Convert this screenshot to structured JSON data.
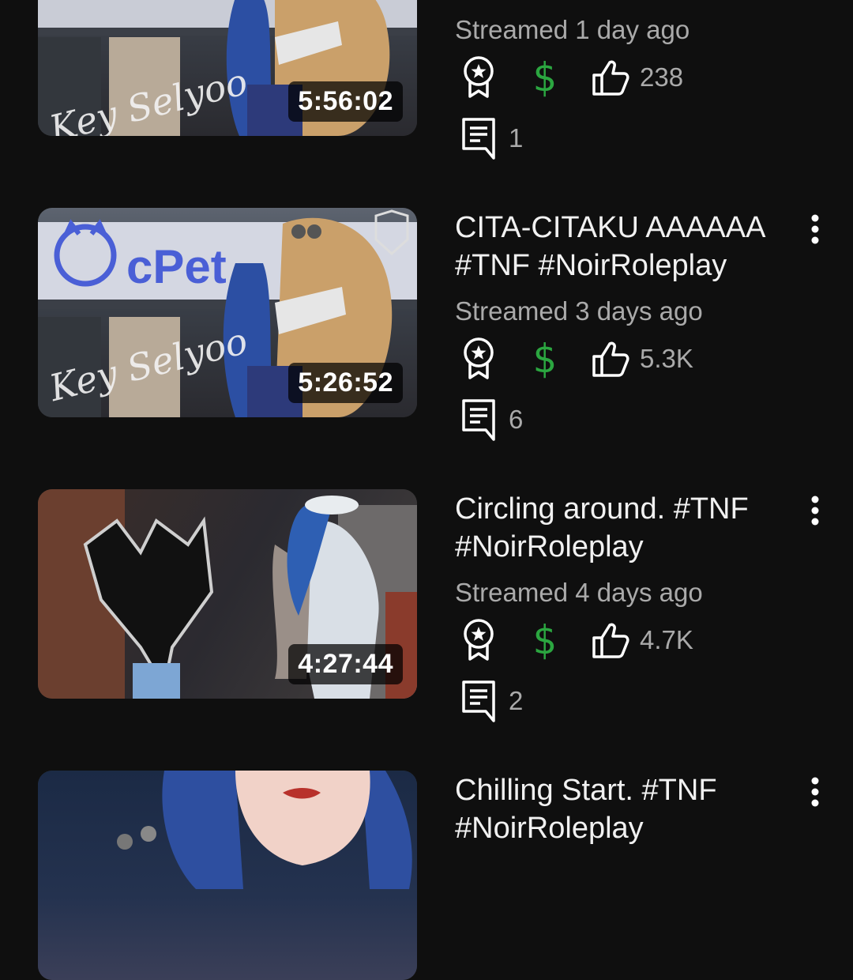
{
  "videos": [
    {
      "duration": "5:56:02",
      "meta": "Streamed 1 day ago",
      "likes": "238",
      "comments": "1",
      "thumb_sign": "Key Selyoo"
    },
    {
      "title": "CITA-CITAKU AAAAAA #TNF #NoirRoleplay",
      "duration": "5:26:52",
      "meta": "Streamed 3 days ago",
      "likes": "5.3K",
      "comments": "6",
      "thumb_store": "cPet",
      "thumb_sign": "Key Selyoo"
    },
    {
      "title": "Circling around. #TNF #NoirRoleplay",
      "duration": "4:27:44",
      "meta": "Streamed 4 days ago",
      "likes": "4.7K",
      "comments": "2"
    },
    {
      "title": "Chilling Start. #TNF #NoirRoleplay"
    }
  ],
  "icons": {
    "supporter": "award-icon",
    "super_thanks": "dollar-icon",
    "like": "thumbs-up-icon",
    "comment": "comment-icon",
    "more": "more-vertical-icon"
  },
  "colors": {
    "background": "#0f0f0f",
    "title": "#f1f1f1",
    "meta": "#aaaaaa",
    "dollar": "#2ba640",
    "store_sign": "#4a5fd6"
  }
}
